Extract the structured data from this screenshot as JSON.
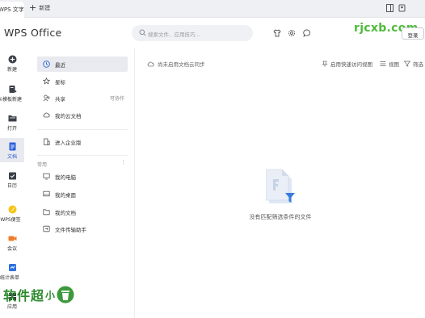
{
  "tabbar": {
    "tab_label": "WPS 文字",
    "new_tab_label": "新建"
  },
  "header": {
    "logo": "WPS Office",
    "search_placeholder": "搜索文件、应用技巧...",
    "login_label": "登录",
    "watermark": "rjcxb.com"
  },
  "leftnav": {
    "items": [
      {
        "label": "新建",
        "icon": "plus-circle-icon"
      },
      {
        "label": "从模板新建",
        "icon": "template-icon"
      },
      {
        "label": "打开",
        "icon": "folder-icon"
      },
      {
        "label": "文档",
        "icon": "document-icon"
      },
      {
        "label": "日历",
        "icon": "calendar-icon"
      },
      {
        "label": "WPS便签",
        "icon": "note-icon"
      },
      {
        "label": "会议",
        "icon": "meeting-icon"
      },
      {
        "label": "统计表单",
        "icon": "form-icon"
      },
      {
        "label": "应用",
        "icon": "apps-icon"
      }
    ]
  },
  "sidebar": {
    "items": [
      {
        "label": "最近",
        "icon": "clock-icon"
      },
      {
        "label": "星标",
        "icon": "star-icon"
      },
      {
        "label": "共享",
        "icon": "share-icon",
        "extra": "可协作"
      },
      {
        "label": "我的云文档",
        "icon": "cloud-icon"
      },
      {
        "label": "进入企业版",
        "icon": "enterprise-icon"
      }
    ],
    "section_label": "常用",
    "common": [
      {
        "label": "我的电脑",
        "icon": "computer-icon"
      },
      {
        "label": "我的桌面",
        "icon": "desktop-icon"
      },
      {
        "label": "我的文档",
        "icon": "folder-doc-icon"
      },
      {
        "label": "文件传输助手",
        "icon": "transfer-icon"
      }
    ]
  },
  "main": {
    "cloud_note": "尚未启用文档云同步",
    "toolbar": {
      "quick_access": "启用快速访问视图",
      "view": "视图",
      "filter": "筛选"
    },
    "empty_text": "没有匹配筛选条件的文件"
  },
  "bottom_watermark": {
    "text": "软件超",
    "small": "小"
  },
  "colors": {
    "accent": "#2b5fd9",
    "watermark_green": "#4dbb3a"
  }
}
